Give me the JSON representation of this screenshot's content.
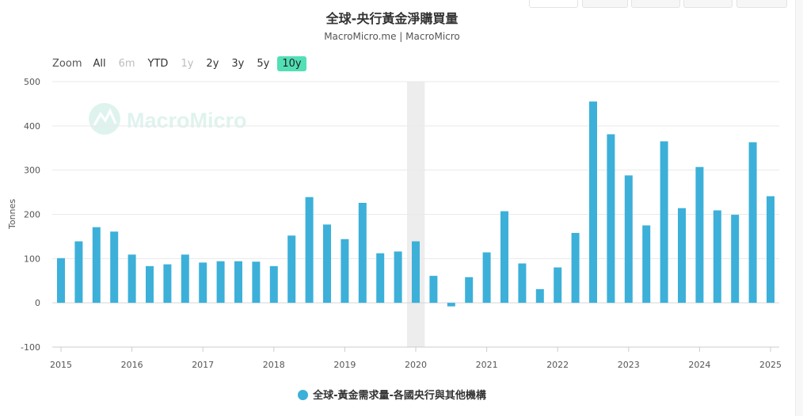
{
  "chart_data": {
    "type": "bar",
    "title": "全球-央行黃金淨購買量",
    "subtitle": "MacroMicro.me | MacroMicro",
    "ylabel": "Tonnes",
    "ylim": [
      -100,
      500
    ],
    "yticks": [
      -100,
      0,
      100,
      200,
      300,
      400,
      500
    ],
    "xticks": [
      "2015",
      "2016",
      "2017",
      "2018",
      "2019",
      "2020",
      "2021",
      "2022",
      "2023",
      "2024",
      "2025"
    ],
    "grid": true,
    "legend_position": "bottom",
    "watermark": "MacroMicro",
    "highlight_period": [
      "2020 Q1",
      "2020 Q1"
    ],
    "series": [
      {
        "name": "全球-黃金需求量-各國央行與其他機構",
        "color": "#3cb0d9",
        "x": [
          "2015 Q1",
          "2015 Q2",
          "2015 Q3",
          "2015 Q4",
          "2016 Q1",
          "2016 Q2",
          "2016 Q3",
          "2016 Q4",
          "2017 Q1",
          "2017 Q2",
          "2017 Q3",
          "2017 Q4",
          "2018 Q1",
          "2018 Q2",
          "2018 Q3",
          "2018 Q4",
          "2019 Q1",
          "2019 Q2",
          "2019 Q3",
          "2019 Q4",
          "2020 Q1",
          "2020 Q2",
          "2020 Q3",
          "2020 Q4",
          "2021 Q1",
          "2021 Q2",
          "2021 Q3",
          "2021 Q4",
          "2022 Q1",
          "2022 Q2",
          "2022 Q3",
          "2022 Q4",
          "2023 Q1",
          "2023 Q2",
          "2023 Q3",
          "2023 Q4",
          "2024 Q1",
          "2024 Q2",
          "2024 Q3",
          "2024 Q4",
          "2025 Q1"
        ],
        "values": [
          101,
          139,
          171,
          161,
          109,
          83,
          87,
          109,
          91,
          94,
          94,
          93,
          83,
          152,
          239,
          177,
          144,
          226,
          112,
          116,
          139,
          61,
          -8,
          58,
          114,
          207,
          89,
          31,
          80,
          158,
          455,
          381,
          288,
          175,
          365,
          214,
          307,
          209,
          199,
          363,
          241
        ]
      }
    ]
  },
  "zoom": {
    "label": "Zoom",
    "buttons": [
      {
        "label": "All",
        "state": "normal"
      },
      {
        "label": "6m",
        "state": "disabled"
      },
      {
        "label": "YTD",
        "state": "normal"
      },
      {
        "label": "1y",
        "state": "disabled"
      },
      {
        "label": "2y",
        "state": "normal"
      },
      {
        "label": "3y",
        "state": "normal"
      },
      {
        "label": "5y",
        "state": "normal"
      },
      {
        "label": "10y",
        "state": "active"
      }
    ]
  },
  "colors": {
    "bar": "#3cb0d9",
    "active_zoom": "#52dfb6",
    "watermark": "#dff3ee",
    "highlight_band": "#ededed"
  }
}
